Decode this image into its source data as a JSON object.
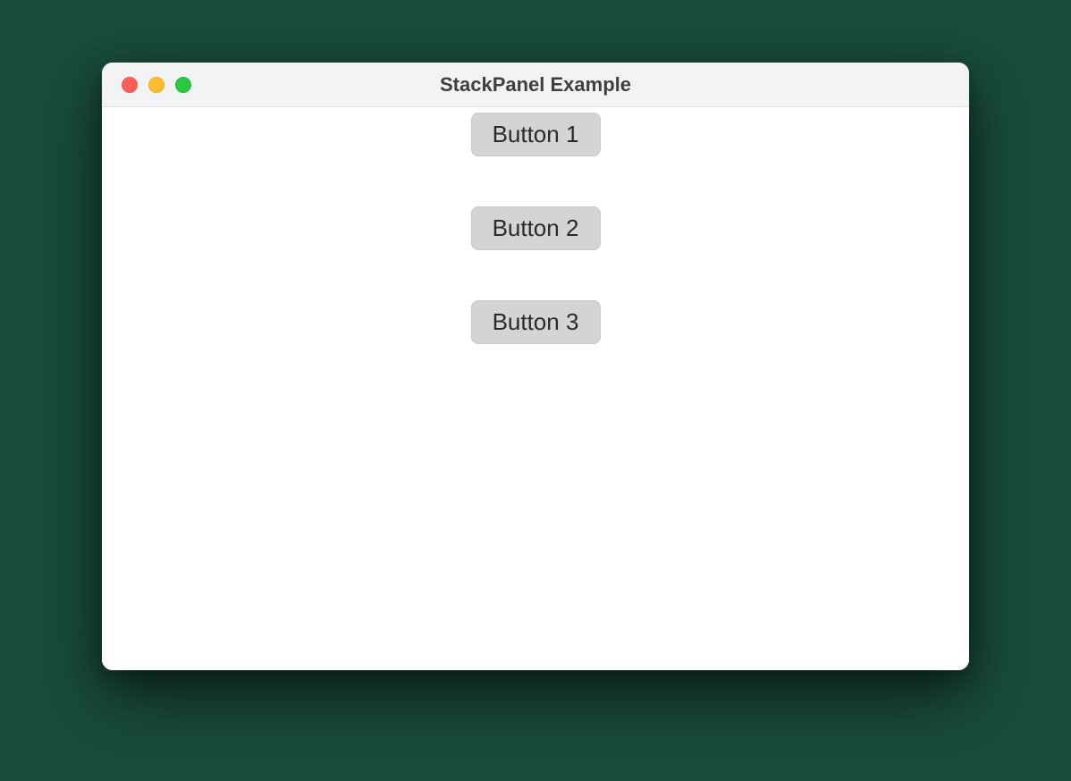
{
  "window": {
    "title": "StackPanel Example"
  },
  "buttons": [
    {
      "label": "Button 1"
    },
    {
      "label": "Button 2"
    },
    {
      "label": "Button 3"
    }
  ]
}
